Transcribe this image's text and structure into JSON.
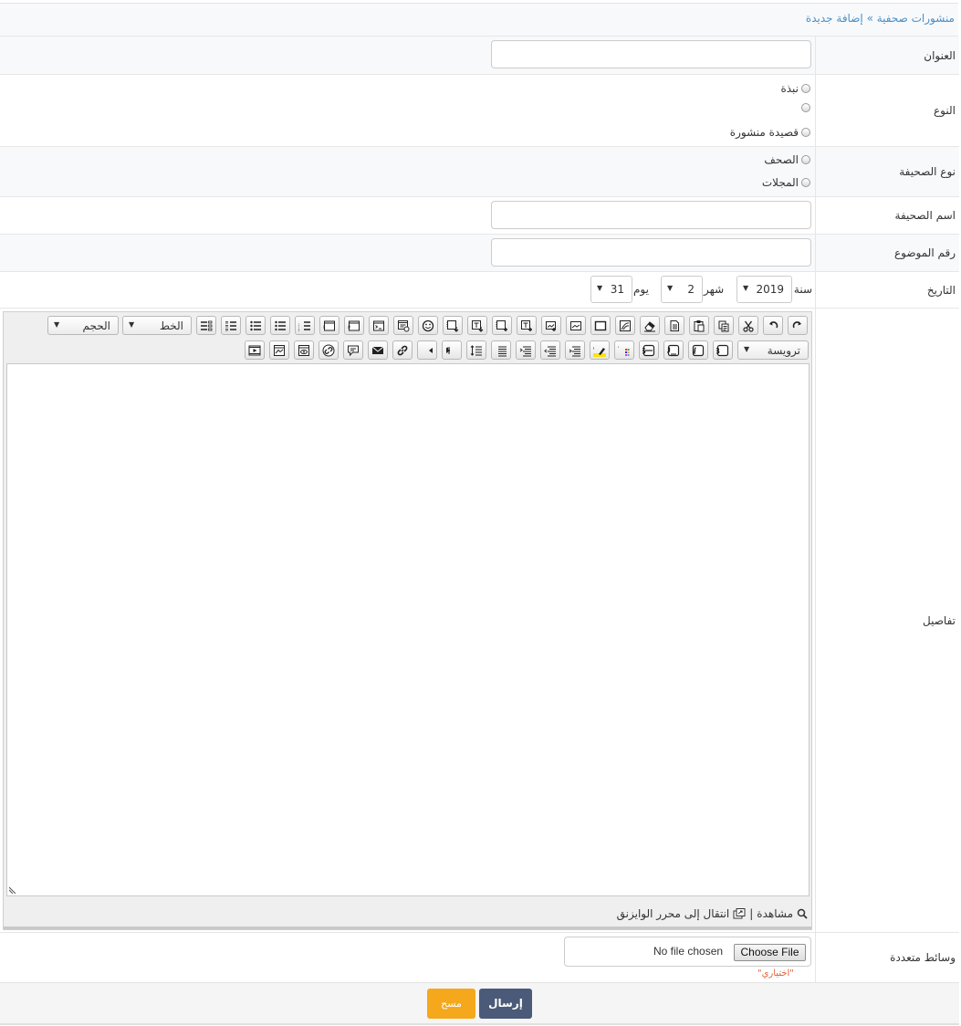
{
  "breadcrumb": {
    "section": "منشورات صحفية",
    "separator": "»",
    "current": "إضافة جديدة"
  },
  "fields": {
    "title": {
      "label": "العنوان",
      "value": ""
    },
    "type": {
      "label": "النوع",
      "options": [
        "نبذة",
        "",
        "قصيدة منشورة"
      ]
    },
    "paper_type": {
      "label": "نوع الصحيفة",
      "options": [
        "الصحف",
        "المجلات"
      ]
    },
    "paper_name": {
      "label": "اسم الصحيفة",
      "value": ""
    },
    "topic_number": {
      "label": "رقم الموضوع",
      "value": ""
    },
    "date": {
      "label": "التاريخ",
      "year_label": "سنة",
      "year": "2019",
      "month_label": "شهر",
      "month": "2",
      "day_label": "يوم",
      "day": "31"
    },
    "details": {
      "label": "تفاصيل"
    },
    "media": {
      "label": "وسائط متعددة",
      "choose_label": "Choose File",
      "no_file": "No file chosen",
      "optional": "\"اختياري\""
    }
  },
  "editor": {
    "font_select": "الخط",
    "size_select": "الحجم",
    "heading_select": "ترويسة",
    "preview_label": "مشاهدة",
    "status_separator": "|",
    "switch_label": "انتقال إلى محرر الوايزنق",
    "toolbar_row1": [
      "redo-icon",
      "undo-icon",
      "cut-icon",
      "copy-icon",
      "paste-icon",
      "paste-text-icon",
      "eraser-icon",
      "insert-symbol-icon",
      "box-icon",
      "insert-image-icon",
      "insert-image-url-icon",
      "insert-text-box-icon",
      "insert-bbcode-box-icon",
      "text-down-icon",
      "bbcode-down-icon",
      "emoji-icon",
      "code-box-icon",
      "terminal-icon",
      "php-icon",
      "html-icon",
      "ordered-list-icon",
      "unordered-list-icon",
      "unordered-list-2-icon",
      "indent-list-icon",
      "outdent-list-icon"
    ],
    "toolbar_row2": [
      "bold-icon",
      "italic-icon",
      "underline-icon",
      "strikethrough-icon",
      "text-color-icon",
      "highlight-icon",
      "align-right-icon",
      "align-center-icon",
      "align-left-icon",
      "align-justify-icon",
      "line-spacing-icon",
      "rtl-icon",
      "ltr-icon",
      "link-icon",
      "email-icon",
      "quote-icon",
      "unlink-icon",
      "insert-attachment-icon",
      "insert-media-icon",
      "video-icon"
    ]
  },
  "actions": {
    "submit": "إرسال",
    "clear": "مسح"
  },
  "colors": {
    "link": "#4a90c8",
    "submit_bg": "#4a5a78",
    "clear_bg": "#f5a81c",
    "optional_text": "#e0623a"
  }
}
